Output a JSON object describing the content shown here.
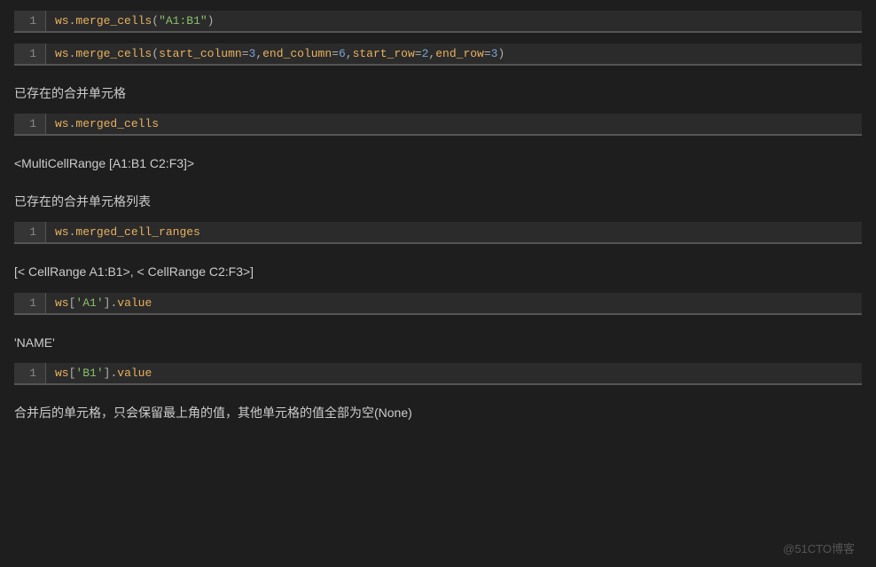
{
  "blocks": [
    {
      "type": "code",
      "line": "1",
      "tokens": [
        {
          "t": "ws",
          "c": "ident"
        },
        {
          "t": ".",
          "c": "punct"
        },
        {
          "t": "merge_cells",
          "c": "method"
        },
        {
          "t": "(",
          "c": "paren"
        },
        {
          "t": "\"A1:B1\"",
          "c": "str"
        },
        {
          "t": ")",
          "c": "paren"
        }
      ]
    },
    {
      "type": "code",
      "line": "1",
      "tokens": [
        {
          "t": "ws",
          "c": "ident"
        },
        {
          "t": ".",
          "c": "punct"
        },
        {
          "t": "merge_cells",
          "c": "method"
        },
        {
          "t": "(",
          "c": "paren"
        },
        {
          "t": "start_column",
          "c": "kw"
        },
        {
          "t": "=",
          "c": "punct"
        },
        {
          "t": "3",
          "c": "num"
        },
        {
          "t": ",",
          "c": "punct"
        },
        {
          "t": "end_column",
          "c": "kw"
        },
        {
          "t": "=",
          "c": "punct"
        },
        {
          "t": "6",
          "c": "num"
        },
        {
          "t": ",",
          "c": "punct"
        },
        {
          "t": "start_row",
          "c": "kw"
        },
        {
          "t": "=",
          "c": "punct"
        },
        {
          "t": "2",
          "c": "num"
        },
        {
          "t": ",",
          "c": "punct"
        },
        {
          "t": "end_row",
          "c": "kw"
        },
        {
          "t": "=",
          "c": "punct"
        },
        {
          "t": "3",
          "c": "num"
        },
        {
          "t": ")",
          "c": "paren"
        }
      ]
    },
    {
      "type": "text",
      "text": "已存在的合并单元格"
    },
    {
      "type": "code",
      "line": "1",
      "tokens": [
        {
          "t": "ws",
          "c": "ident"
        },
        {
          "t": ".",
          "c": "punct"
        },
        {
          "t": "merged_cells",
          "c": "method"
        }
      ]
    },
    {
      "type": "text",
      "text": "<MultiCellRange [A1:B1 C2:F3]>"
    },
    {
      "type": "text",
      "text": "已存在的合并单元格列表"
    },
    {
      "type": "code",
      "line": "1",
      "tokens": [
        {
          "t": "ws",
          "c": "ident"
        },
        {
          "t": ".",
          "c": "punct"
        },
        {
          "t": "merged_cell_ranges",
          "c": "method"
        }
      ]
    },
    {
      "type": "text",
      "text": "[< CellRange A1:B1>, < CellRange C2:F3>]"
    },
    {
      "type": "code",
      "line": "1",
      "tokens": [
        {
          "t": "ws",
          "c": "ident"
        },
        {
          "t": "[",
          "c": "punct"
        },
        {
          "t": "'A1'",
          "c": "str"
        },
        {
          "t": "]",
          "c": "punct"
        },
        {
          "t": ".",
          "c": "punct"
        },
        {
          "t": "value",
          "c": "method"
        }
      ]
    },
    {
      "type": "text",
      "text": "'NAME'"
    },
    {
      "type": "code",
      "line": "1",
      "tokens": [
        {
          "t": "ws",
          "c": "ident"
        },
        {
          "t": "[",
          "c": "punct"
        },
        {
          "t": "'B1'",
          "c": "str"
        },
        {
          "t": "]",
          "c": "punct"
        },
        {
          "t": ".",
          "c": "punct"
        },
        {
          "t": "value",
          "c": "method"
        }
      ]
    },
    {
      "type": "text",
      "text": "合并后的单元格，只会保留最上角的值，其他单元格的值全部为空(None)"
    }
  ],
  "watermark": "@51CTO博客"
}
